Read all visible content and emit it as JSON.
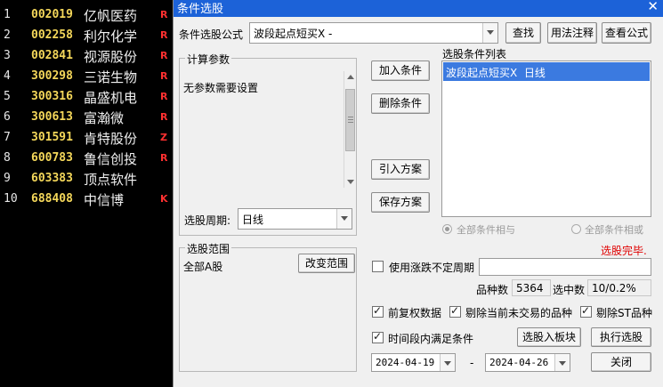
{
  "stock_list": {
    "rows": [
      {
        "idx": "1",
        "code": "002019",
        "name": "亿帆医药",
        "flag": "R"
      },
      {
        "idx": "2",
        "code": "002258",
        "name": "利尔化学",
        "flag": "R"
      },
      {
        "idx": "3",
        "code": "002841",
        "name": "视源股份",
        "flag": "R"
      },
      {
        "idx": "4",
        "code": "300298",
        "name": "三诺生物",
        "flag": "R"
      },
      {
        "idx": "5",
        "code": "300316",
        "name": "晶盛机电",
        "flag": "R"
      },
      {
        "idx": "6",
        "code": "300613",
        "name": "富瀚微",
        "flag": "R"
      },
      {
        "idx": "7",
        "code": "301591",
        "name": "肯特股份",
        "flag": "Z"
      },
      {
        "idx": "8",
        "code": "600783",
        "name": "鲁信创投",
        "flag": "R"
      },
      {
        "idx": "9",
        "code": "603383",
        "name": "顶点软件",
        "flag": ""
      },
      {
        "idx": "10",
        "code": "688408",
        "name": "中信博",
        "flag": "K"
      }
    ],
    "colors": {
      "code": "#f4d75a",
      "flag": "#ff3030",
      "name": "#f0f0f0",
      "background": "#000000"
    }
  },
  "dialog": {
    "title": "条件选股",
    "close_icon": "close-icon",
    "formula_label": "条件选股公式",
    "formula_value": "波段起点短买X -",
    "find_button": "查找",
    "usage_button": "用法注释",
    "view_formula_button": "查看公式",
    "params": {
      "title": "计算参数",
      "text": "无参数需要设置"
    },
    "period_label": "选股周期:",
    "period_value": "日线",
    "scope": {
      "title": "选股范围",
      "value": "全部A股",
      "change_button": "改变范围"
    },
    "add_condition_button": "加入条件",
    "delete_condition_button": "删除条件",
    "import_plan_button": "引入方案",
    "save_plan_button": "保存方案",
    "condition_list": {
      "title": "选股条件列表",
      "items": [
        "波段起点短买X  日线"
      ]
    },
    "logic": {
      "and_label": "全部条件相与",
      "or_label": "全部条件相或"
    },
    "status_text": "选股完毕.",
    "status_color": "#e00000",
    "variable_period": {
      "label": "使用涨跌不定周期",
      "checked": false,
      "value": ""
    },
    "counts": {
      "total_label": "品种数",
      "total_value": "5364",
      "selected_label": "选中数",
      "selected_value": "10/0.2%"
    },
    "options": {
      "adjust_label": "前复权数据",
      "adjust_checked": true,
      "exclude_untraded_label": "剔除当前未交易的品种",
      "exclude_untraded_checked": true,
      "exclude_st_label": "剔除ST品种",
      "exclude_st_checked": true,
      "time_range_label": "时间段内满足条件",
      "time_range_checked": true
    },
    "to_board_button": "选股入板块",
    "execute_button": "执行选股",
    "date_from": "2024-04-19",
    "date_sep": "-",
    "date_to": "2024-04-26",
    "close_button": "关闭",
    "accent_color": "#1c62d8"
  }
}
